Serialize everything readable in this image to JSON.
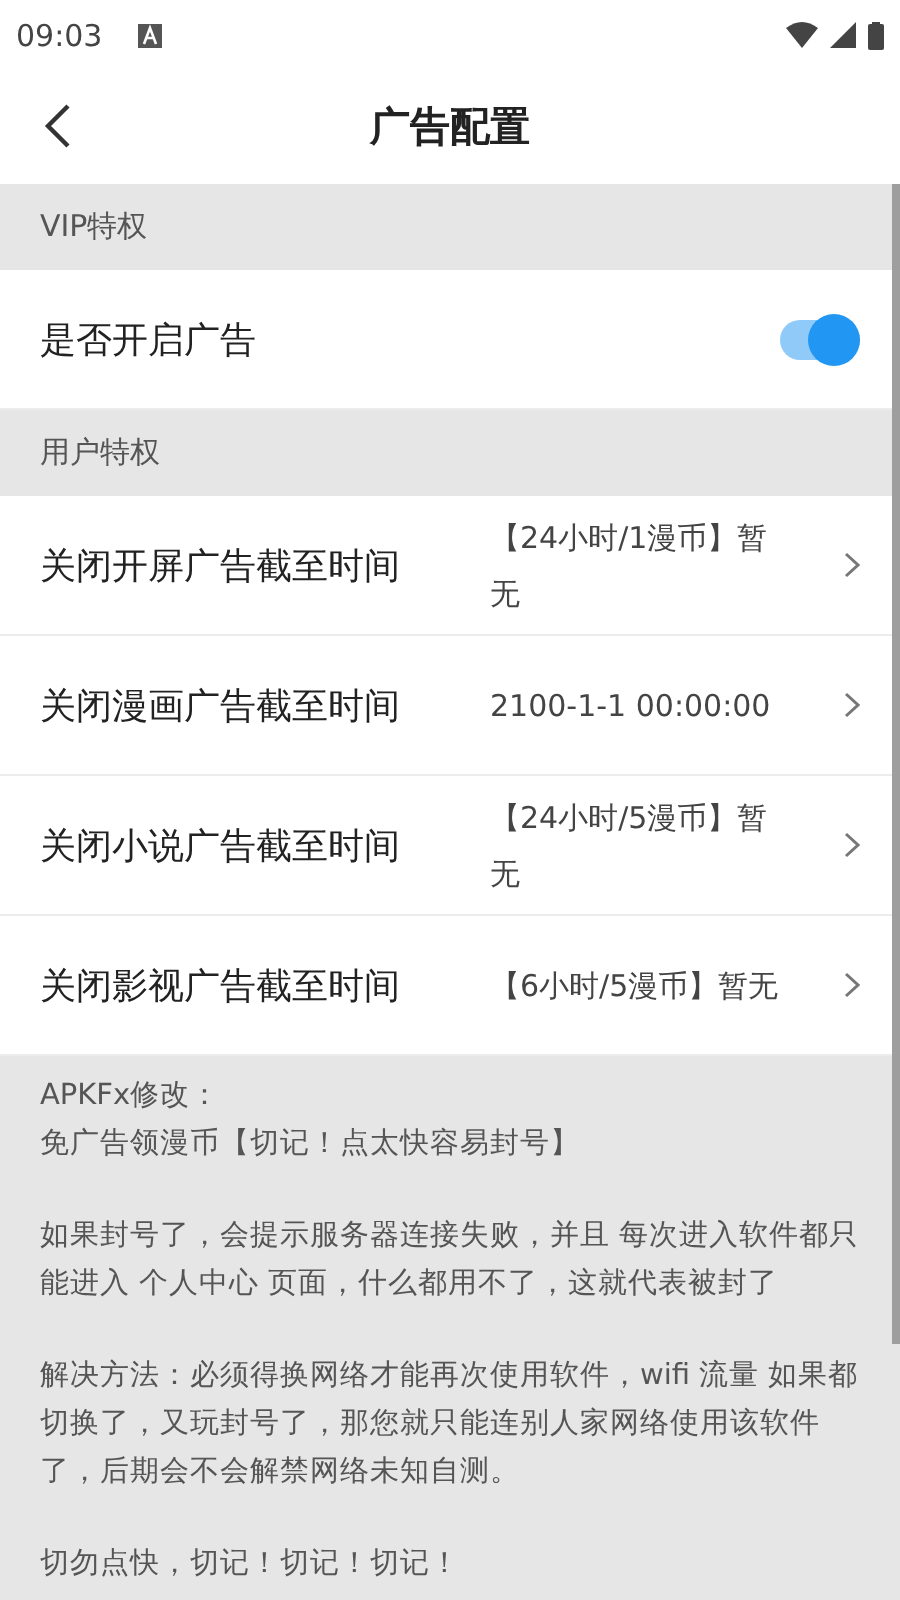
{
  "status_bar": {
    "time": "09:03"
  },
  "header": {
    "title": "广告配置"
  },
  "sections": [
    {
      "title": "VIP特权",
      "rows": [
        {
          "kind": "toggle",
          "label": "是否开启广告",
          "on": true
        }
      ]
    },
    {
      "title": "用户特权",
      "rows": [
        {
          "kind": "link",
          "label": "关闭开屏广告截至时间",
          "value": "【24小时/1漫币】暂无"
        },
        {
          "kind": "link",
          "label": "关闭漫画广告截至时间",
          "value": "2100-1-1 00:00:00"
        },
        {
          "kind": "link",
          "label": "关闭小说广告截至时间",
          "value": "【24小时/5漫币】暂无"
        },
        {
          "kind": "link",
          "label": "关闭影视广告截至时间",
          "value": "【6小时/5漫币】暂无"
        }
      ]
    }
  ],
  "notes": [
    [
      "APKFx修改：",
      "免广告领漫币【切记！点太快容易封号】"
    ],
    [
      "如果封号了，会提示服务器连接失败，并且 每次进入软件都只能进入 个人中心 页面，什么都用不了，这就代表被封了"
    ],
    [
      "解决方法：必须得换网络才能再次使用软件，wifi 流量 如果都切换了，又玩封号了，那您就只能连别人家网络使用该软件了，后期会不会解禁网络未知自测。"
    ],
    [
      "切勿点快，切记！切记！切记！"
    ]
  ]
}
